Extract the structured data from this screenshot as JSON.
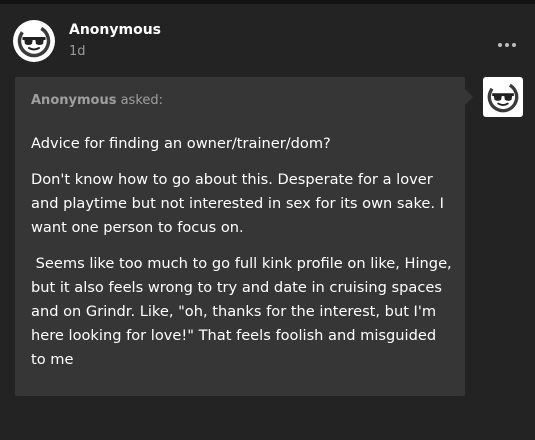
{
  "post": {
    "author_name": "Anonymous",
    "timestamp": "1d",
    "more_menu_icon": "ellipsis-horizontal-icon",
    "avatar_icon": "anonymous-sunglasses-avatar-icon"
  },
  "ask": {
    "asker_name": "Anonymous",
    "asked_label": " asked:",
    "asker_avatar_icon": "anonymous-sunglasses-avatar-icon",
    "paragraphs": [
      "Advice for finding an owner/trainer/dom?",
      "Don't know how to go about this. Desperate for a lover and playtime but not interested in sex for its own sake. I want one person to focus on.",
      " Seems like too much to go full kink profile on like, Hinge, but it also feels wrong to try and date in cruising spaces and on Grindr. Like, \"oh, thanks for the interest, but I'm here looking for love!\" That feels foolish and misguided to me"
    ]
  },
  "colors": {
    "page_background": "#111214",
    "card_background": "#232323",
    "bubble_background": "#363636",
    "text_primary": "#ffffff",
    "text_secondary": "#9b9b9b"
  }
}
